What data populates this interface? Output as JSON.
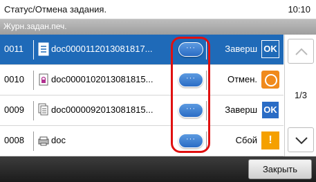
{
  "header": {
    "title": "Статус/Отмена задания.",
    "time": "10:10",
    "subtitle": "Журн.задан.печ."
  },
  "jobs": [
    {
      "number": "0011",
      "name": "doc0000112013081817...",
      "status": "Заверш",
      "file_icon": "document-icon",
      "status_icon": "ok-icon",
      "selected": true
    },
    {
      "number": "0010",
      "name": "doc0000102013081815...",
      "status": "Отмен.",
      "file_icon": "lock-document-icon",
      "status_icon": "cancel-icon",
      "selected": false
    },
    {
      "number": "0009",
      "name": "doc0000092013081815...",
      "status": "Заверш",
      "file_icon": "multi-document-icon",
      "status_icon": "ok-icon",
      "selected": false
    },
    {
      "number": "0008",
      "name": "doc",
      "status": "Сбой",
      "file_icon": "printer-icon",
      "status_icon": "error-icon",
      "selected": false
    }
  ],
  "status_icon_labels": {
    "ok": "OK",
    "error": "!"
  },
  "pagination": {
    "page": "1/3"
  },
  "footer": {
    "close_label": "Закрыть"
  },
  "colors": {
    "selected_row": "#1f6ab8",
    "highlight": "#e01010",
    "ok": "#2a6cc5",
    "cancel": "#f08a1c",
    "error": "#f5a000"
  }
}
